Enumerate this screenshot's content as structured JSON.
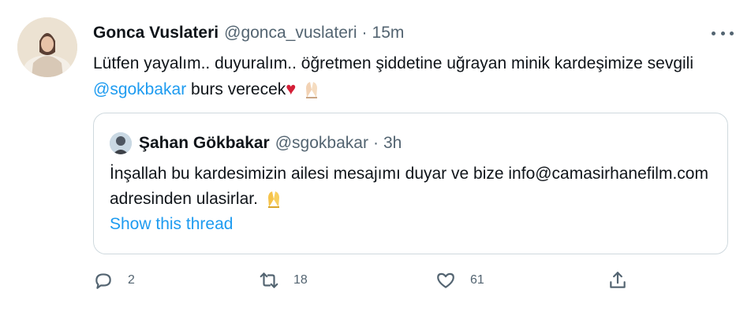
{
  "tweet": {
    "author_name": "Gonca Vuslateri",
    "author_handle": "@gonca_vuslateri",
    "separator": "·",
    "time": "15m",
    "text_part1": "Lütfen yayalım.. duyuralım.. öğretmen şiddetine uğrayan minik kardeşimize sevgili ",
    "mention": "@sgokbakar",
    "text_part2": " burs verecek",
    "heart": "♥"
  },
  "quote": {
    "author_name": "Şahan Gökbakar",
    "author_handle": "@sgokbakar",
    "separator": "·",
    "time": "3h",
    "text": "İnşallah bu kardesimizin ailesi mesajımı duyar ve bize info@camasirhanefilm.com adresinden ulasirlar.",
    "show_thread": "Show this thread"
  },
  "actions": {
    "reply_count": "2",
    "retweet_count": "18",
    "like_count": "61"
  },
  "icons": [
    "more-icon",
    "reply-icon",
    "retweet-icon",
    "like-icon",
    "share-icon",
    "folded-hands-icon",
    "heart-icon"
  ],
  "colors": {
    "accent": "#1d9bf0",
    "text": "#0f1419",
    "muted": "#536471",
    "border": "#cfd9de",
    "heart": "#d41f37"
  }
}
